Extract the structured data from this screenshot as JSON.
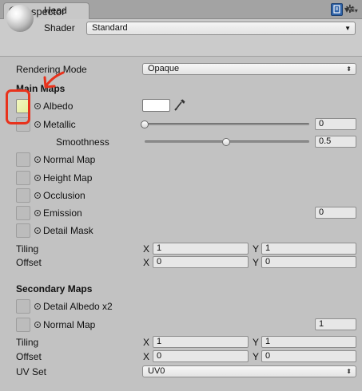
{
  "tab": {
    "title": "Inspector"
  },
  "header": {
    "object_name": "Head",
    "shader_label": "Shader",
    "shader_value": "Standard"
  },
  "rendering_mode": {
    "label": "Rendering Mode",
    "value": "Opaque"
  },
  "main_maps": {
    "title": "Main Maps",
    "albedo": {
      "label": "Albedo",
      "color": "#ffffff"
    },
    "metallic": {
      "label": "Metallic",
      "value": "0",
      "level": 0.0
    },
    "smoothness": {
      "label": "Smoothness",
      "value": "0.5",
      "level": 0.5
    },
    "normal_map": {
      "label": "Normal Map"
    },
    "height_map": {
      "label": "Height Map"
    },
    "occlusion": {
      "label": "Occlusion"
    },
    "emission": {
      "label": "Emission",
      "value": "0"
    },
    "detail_mask": {
      "label": "Detail Mask"
    },
    "tiling": {
      "label": "Tiling",
      "x_label": "X",
      "x": "1",
      "y_label": "Y",
      "y": "1"
    },
    "offset": {
      "label": "Offset",
      "x_label": "X",
      "x": "0",
      "y_label": "Y",
      "y": "0"
    }
  },
  "secondary_maps": {
    "title": "Secondary Maps",
    "detail_albedo": {
      "label": "Detail Albedo x2"
    },
    "normal_map": {
      "label": "Normal Map",
      "value": "1"
    },
    "tiling": {
      "label": "Tiling",
      "x_label": "X",
      "x": "1",
      "y_label": "Y",
      "y": "1"
    },
    "offset": {
      "label": "Offset",
      "x_label": "X",
      "x": "0",
      "y_label": "Y",
      "y": "0"
    },
    "uv_set": {
      "label": "UV Set",
      "value": "UV0"
    }
  },
  "annotation": {
    "color": "#e8321c"
  }
}
